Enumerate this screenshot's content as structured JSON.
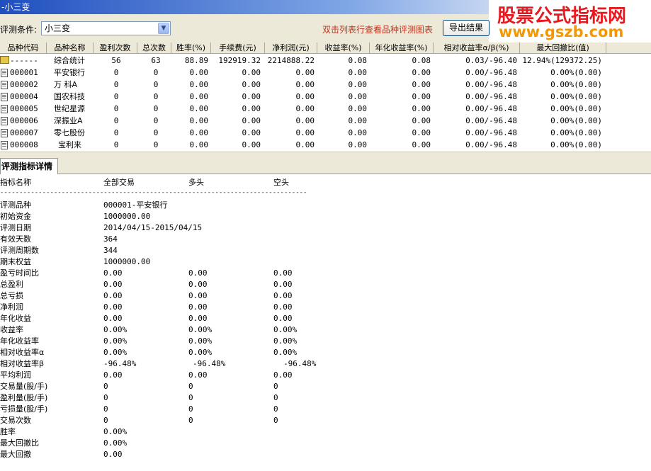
{
  "window": {
    "title": "-小三变"
  },
  "watermark": {
    "line1": "股票公式指标网",
    "line2": "www.gszb.com"
  },
  "toolbar": {
    "condition_label": "评测条件:",
    "condition_value": "小三变",
    "hint": "双击列表行查看品种评测图表",
    "export_label": "导出结果"
  },
  "table": {
    "headers": [
      "品种代码",
      "品种名称",
      "盈利次数",
      "总次数",
      "胜率(%)",
      "手续费(元)",
      "净利润(元)",
      "收益率(%)",
      "年化收益率(%)",
      "相对收益率α/β(%)",
      "最大回撤比(值)"
    ],
    "rows": [
      {
        "icon": "summary-icon",
        "cells": [
          "------",
          "综合统计",
          "56",
          "63",
          "88.89",
          "192919.32",
          "2214888.22",
          "0.08",
          "0.08",
          "0.03/-96.40",
          "12.94%(129372.25)"
        ]
      },
      {
        "icon": "document-icon",
        "cells": [
          "000001",
          "平安银行",
          "0",
          "0",
          "0.00",
          "0.00",
          "0.00",
          "0.00",
          "0.00",
          "0.00/-96.48",
          "0.00%(0.00)"
        ]
      },
      {
        "icon": "document-icon",
        "cells": [
          "000002",
          "万  科A",
          "0",
          "0",
          "0.00",
          "0.00",
          "0.00",
          "0.00",
          "0.00",
          "0.00/-96.48",
          "0.00%(0.00)"
        ]
      },
      {
        "icon": "document-icon",
        "cells": [
          "000004",
          "国农科技",
          "0",
          "0",
          "0.00",
          "0.00",
          "0.00",
          "0.00",
          "0.00",
          "0.00/-96.48",
          "0.00%(0.00)"
        ]
      },
      {
        "icon": "document-icon",
        "cells": [
          "000005",
          "世纪星源",
          "0",
          "0",
          "0.00",
          "0.00",
          "0.00",
          "0.00",
          "0.00",
          "0.00/-96.48",
          "0.00%(0.00)"
        ]
      },
      {
        "icon": "document-icon",
        "cells": [
          "000006",
          "深振业A",
          "0",
          "0",
          "0.00",
          "0.00",
          "0.00",
          "0.00",
          "0.00",
          "0.00/-96.48",
          "0.00%(0.00)"
        ]
      },
      {
        "icon": "document-icon",
        "cells": [
          "000007",
          "零七股份",
          "0",
          "0",
          "0.00",
          "0.00",
          "0.00",
          "0.00",
          "0.00",
          "0.00/-96.48",
          "0.00%(0.00)"
        ]
      },
      {
        "icon": "document-icon",
        "cells": [
          "000008",
          "宝利来",
          "0",
          "0",
          "0.00",
          "0.00",
          "0.00",
          "0.00",
          "0.00",
          "0.00/-96.48",
          "0.00%(0.00)"
        ]
      }
    ]
  },
  "tabs": {
    "detail_tab_label": "评测指标详情"
  },
  "detail": {
    "headers": [
      "指标名称",
      "全部交易",
      "多头",
      "空头"
    ],
    "separator": "--------------------------------------------------------------------------------",
    "rows": [
      [
        "评测品种",
        "000001-平安银行",
        "",
        ""
      ],
      [
        "初始资金",
        "1000000.00",
        "",
        ""
      ],
      [
        "评测日期",
        "2014/04/15-2015/04/15",
        "",
        ""
      ],
      [
        "有效天数",
        "364",
        "",
        ""
      ],
      [
        "评测周期数",
        "344",
        "",
        ""
      ],
      [
        "期末权益",
        "1000000.00",
        "",
        ""
      ],
      [
        "盈亏时间比",
        "0.00",
        "0.00",
        "0.00"
      ],
      [
        "总盈利",
        "0.00",
        "0.00",
        "0.00"
      ],
      [
        "总亏损",
        "0.00",
        "0.00",
        "0.00"
      ],
      [
        "净利润",
        "0.00",
        "0.00",
        "0.00"
      ],
      [
        "年化收益",
        "0.00",
        "0.00",
        "0.00"
      ],
      [
        "收益率",
        "0.00%",
        "0.00%",
        "0.00%"
      ],
      [
        "年化收益率",
        "0.00%",
        "0.00%",
        "0.00%"
      ],
      [
        "相对收益率α",
        "0.00%",
        "0.00%",
        "0.00%"
      ],
      [
        "相对收益率β",
        "-96.48%",
        "-96.48%",
        "-96.48%"
      ],
      [
        "平均利润",
        "0.00",
        "0.00",
        "0.00"
      ],
      [
        "交易量(股/手)",
        "0",
        "0",
        "0"
      ],
      [
        "盈利量(股/手)",
        "0",
        "0",
        "0"
      ],
      [
        "亏损量(股/手)",
        "0",
        "0",
        "0"
      ],
      [
        "交易次数",
        "0",
        "0",
        "0"
      ],
      [
        "胜率",
        "0.00%",
        "",
        ""
      ],
      [
        "最大回撤比",
        "0.00%",
        "",
        ""
      ],
      [
        "最大回撤",
        "0.00",
        "",
        ""
      ]
    ]
  }
}
